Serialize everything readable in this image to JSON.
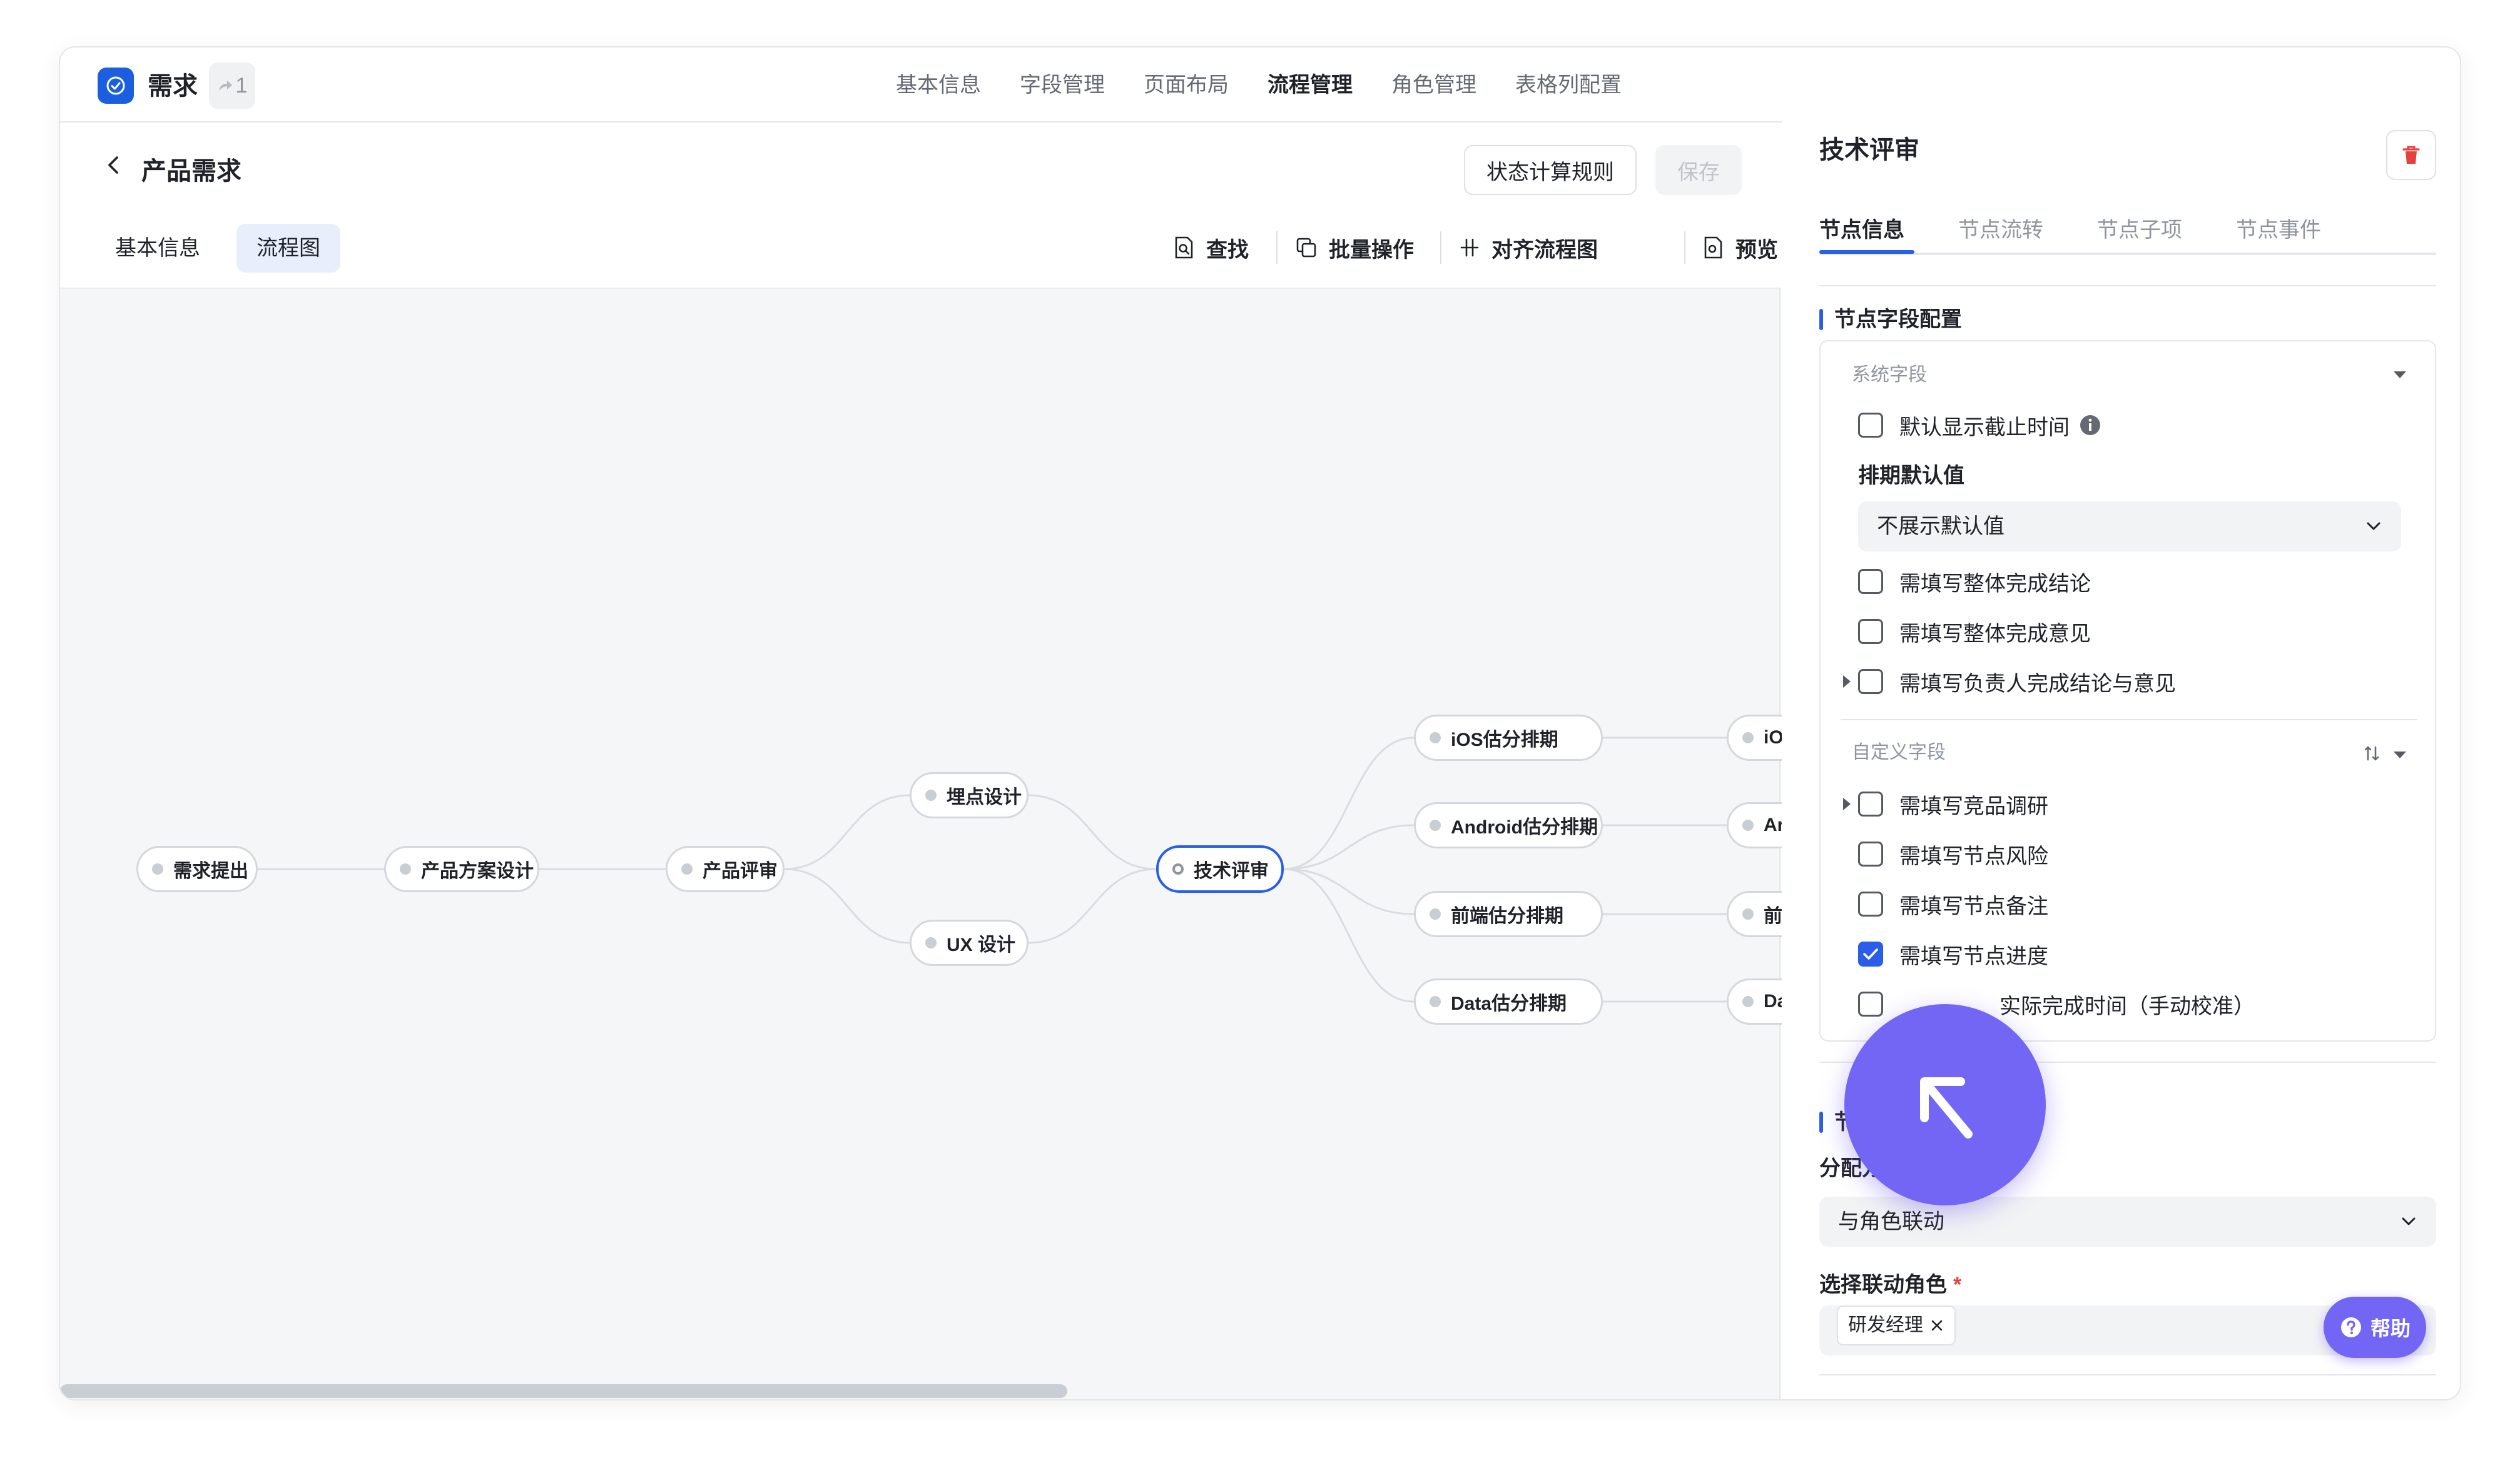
{
  "header": {
    "app_title": "需求",
    "share_count": "1",
    "tabs": [
      "基本信息",
      "字段管理",
      "页面布局",
      "流程管理",
      "角色管理",
      "表格列配置"
    ],
    "active_tab": "流程管理"
  },
  "page": {
    "title": "产品需求",
    "status_rule_button": "状态计算规则",
    "save_button": "保存",
    "subtabs": [
      "基本信息",
      "流程图"
    ],
    "toolbar": {
      "find": "查找",
      "batch": "批量操作",
      "align": "对齐流程图",
      "preview": "预览"
    }
  },
  "flow": {
    "nodes": {
      "n1": "需求提出",
      "n2": "产品方案设计",
      "n3": "产品评审",
      "n4": "埋点设计",
      "n5": "UX 设计",
      "n6": "技术评审",
      "n7": "iOS估分排期",
      "n8": "Android估分排期",
      "n9": "前端估分排期",
      "n10": "Data估分排期",
      "n11": "iO",
      "n12": "Ar",
      "n13": "前",
      "n14": "Da"
    }
  },
  "panel": {
    "title": "技术评审",
    "tabs": [
      "节点信息",
      "节点流转",
      "节点子项",
      "节点事件"
    ],
    "section_field_config": "节点字段配置",
    "system_fields_label": "系统字段",
    "default_deadline": "默认显示截止时间",
    "schedule_default_label": "排期默认值",
    "schedule_default_value": "不展示默认值",
    "sys_items": [
      "需填写整体完成结论",
      "需填写整体完成意见",
      "需填写负责人完成结论与意见"
    ],
    "custom_fields_label": "自定义字段",
    "custom_items": [
      "需填写竞品调研",
      "需填写节点风险",
      "需填写节点备注",
      "需填写节点进度",
      "实际完成时间（手动校准）"
    ],
    "section_two_prefix": "节",
    "assign_label_prefix": "分配方",
    "assign_value": "与角色联动",
    "linked_role_label": "选择联动角色",
    "required_mark": "*",
    "role_tag": "研发经理",
    "help_label": "帮助"
  },
  "colors": {
    "accent": "#2b5ee8",
    "fab": "#7366f5",
    "danger": "#e5413d"
  }
}
